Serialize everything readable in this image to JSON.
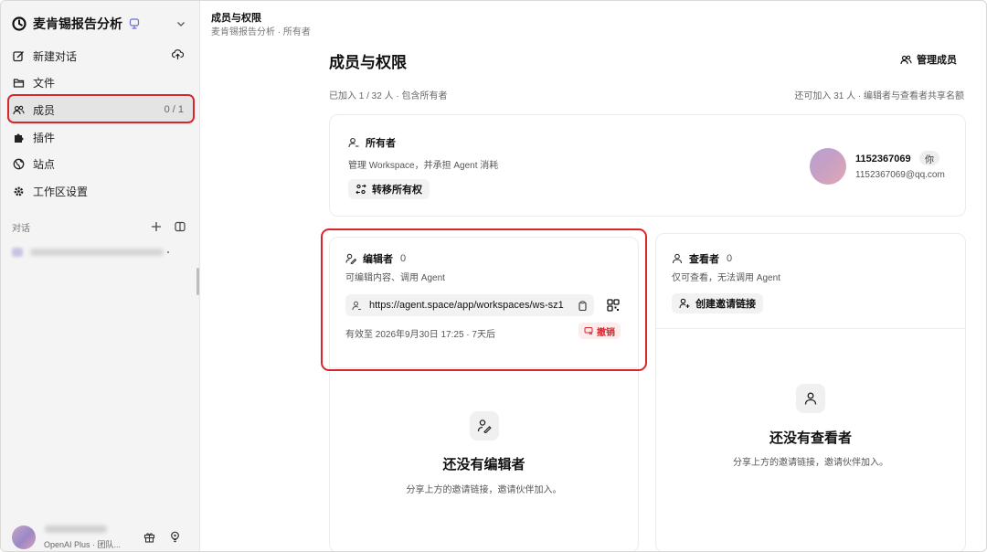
{
  "sidebar": {
    "workspace_title": "麦肯锡报告分析",
    "items": [
      {
        "label": "新建对话",
        "icon": "edit-icon"
      },
      {
        "label": "文件",
        "icon": "folder-icon"
      },
      {
        "label": "成员",
        "icon": "users-icon",
        "count": "0 / 1",
        "active": true
      },
      {
        "label": "插件",
        "icon": "puzzle-icon"
      },
      {
        "label": "站点",
        "icon": "globe-icon"
      },
      {
        "label": "工作区设置",
        "icon": "gear-icon"
      }
    ],
    "section_label": "对话",
    "user_plan": "OpenAI Plus · 团队..."
  },
  "breadcrumb": {
    "title": "成员与权限",
    "path": "麦肯锡报告分析 · 所有者"
  },
  "page": {
    "title": "成员与权限",
    "manage_label": "管理成员",
    "summary_left": "已加入 1 / 32 人 · 包含所有者",
    "summary_right": "还可加入 31 人 · 编辑者与查看者共享名额"
  },
  "owner": {
    "heading": "所有者",
    "description": "管理 Workspace，并承担 Agent 消耗",
    "transfer_label": "转移所有权",
    "name": "1152367069",
    "you_badge": "你",
    "email": "1152367069@qq.com"
  },
  "editor": {
    "heading": "编辑者",
    "count": "0",
    "description": "可编辑内容、调用 Agent",
    "invite_link": "https://agent.space/app/workspaces/ws-sz1",
    "expires": "有效至 2026年9月30日 17:25 · 7天后",
    "revoke_label": "撤销",
    "empty_title": "还没有编辑者",
    "empty_desc": "分享上方的邀请链接，邀请伙伴加入。"
  },
  "viewer": {
    "heading": "查看者",
    "count": "0",
    "description": "仅可查看，无法调用 Agent",
    "create_link_label": "创建邀请链接",
    "empty_title": "还没有查看者",
    "empty_desc": "分享上方的邀请链接，邀请伙伴加入。"
  },
  "colors": {
    "accent_red": "#d9262d",
    "sidebar_bg": "#f4f4f4",
    "chip_bg": "#f2f2f2"
  }
}
